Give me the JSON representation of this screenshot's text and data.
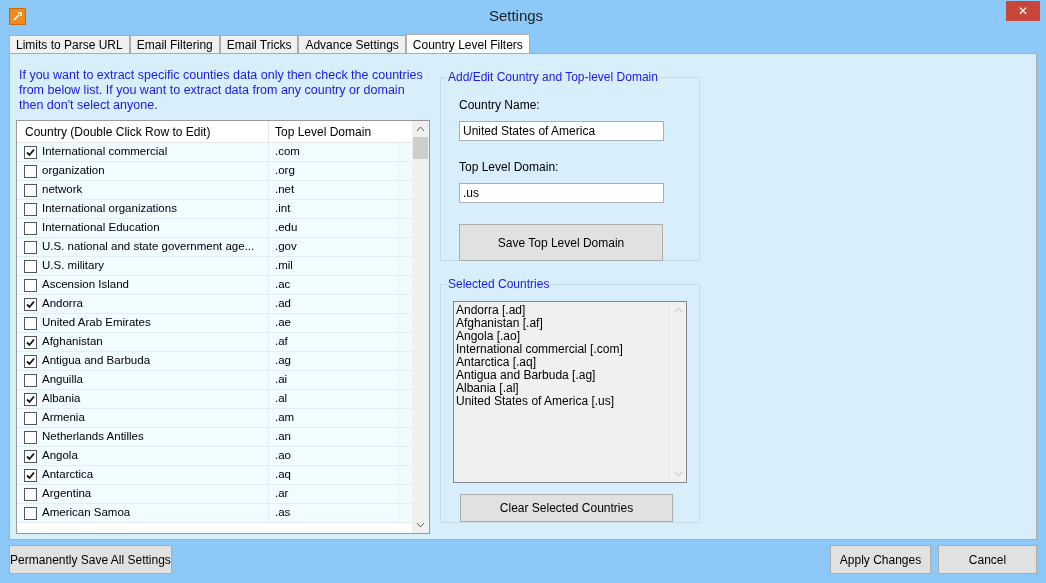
{
  "window": {
    "title": "Settings",
    "close": "✕"
  },
  "tabs": [
    {
      "label": "Limits to Parse URL",
      "selected": false
    },
    {
      "label": "Email Filtering",
      "selected": false
    },
    {
      "label": "Email Tricks",
      "selected": false
    },
    {
      "label": "Advance Settings",
      "selected": false
    },
    {
      "label": "Country Level Filters",
      "selected": true
    }
  ],
  "instructions": "If you want to extract specific counties data only then check the countries from below list. If you want to extract data from any country or domain then don't select anyone.",
  "grid": {
    "columns": [
      "Country (Double Click Row to Edit)",
      "Top Level Domain"
    ],
    "rows": [
      {
        "country": "International commercial",
        "domain": ".com",
        "checked": true
      },
      {
        "country": "organization",
        "domain": ".org",
        "checked": false
      },
      {
        "country": "network",
        "domain": ".net",
        "checked": false
      },
      {
        "country": "International organizations",
        "domain": ".int",
        "checked": false
      },
      {
        "country": "International Education",
        "domain": ".edu",
        "checked": false
      },
      {
        "country": "U.S. national and state government age...",
        "domain": ".gov",
        "checked": false
      },
      {
        "country": "U.S. military",
        "domain": ".mil",
        "checked": false
      },
      {
        "country": "Ascension Island",
        "domain": ".ac",
        "checked": false
      },
      {
        "country": "Andorra",
        "domain": ".ad",
        "checked": true
      },
      {
        "country": "United Arab Emirates",
        "domain": ".ae",
        "checked": false
      },
      {
        "country": "Afghanistan",
        "domain": ".af",
        "checked": true
      },
      {
        "country": "Antigua and Barbuda",
        "domain": ".ag",
        "checked": true
      },
      {
        "country": "Anguilla",
        "domain": ".ai",
        "checked": false
      },
      {
        "country": "Albania",
        "domain": ".al",
        "checked": true
      },
      {
        "country": "Armenia",
        "domain": ".am",
        "checked": false
      },
      {
        "country": "Netherlands Antilles",
        "domain": ".an",
        "checked": false
      },
      {
        "country": "Angola",
        "domain": ".ao",
        "checked": true
      },
      {
        "country": "Antarctica",
        "domain": ".aq",
        "checked": true
      },
      {
        "country": "Argentina",
        "domain": ".ar",
        "checked": false
      },
      {
        "country": "American Samoa",
        "domain": ".as",
        "checked": false
      }
    ]
  },
  "edit_group": {
    "title": "Add/Edit Country and Top-level Domain",
    "country_label": "Country Name:",
    "country_value": "United States of America",
    "domain_label": "Top Level Domain:",
    "domain_value": ".us",
    "save_button": "Save Top Level Domain"
  },
  "selected_group": {
    "title": "Selected Countries",
    "items": [
      "Andorra [.ad]",
      "Afghanistan [.af]",
      "Angola [.ao]",
      "International commercial [.com]",
      "Antarctica [.aq]",
      "Antigua and Barbuda [.ag]",
      "Albania [.al]",
      "United States of America [.us]"
    ],
    "clear_button": "Clear Selected Countries"
  },
  "footer": {
    "save_all": "Permanently Save All Settings",
    "apply": "Apply Changes",
    "cancel": "Cancel"
  }
}
